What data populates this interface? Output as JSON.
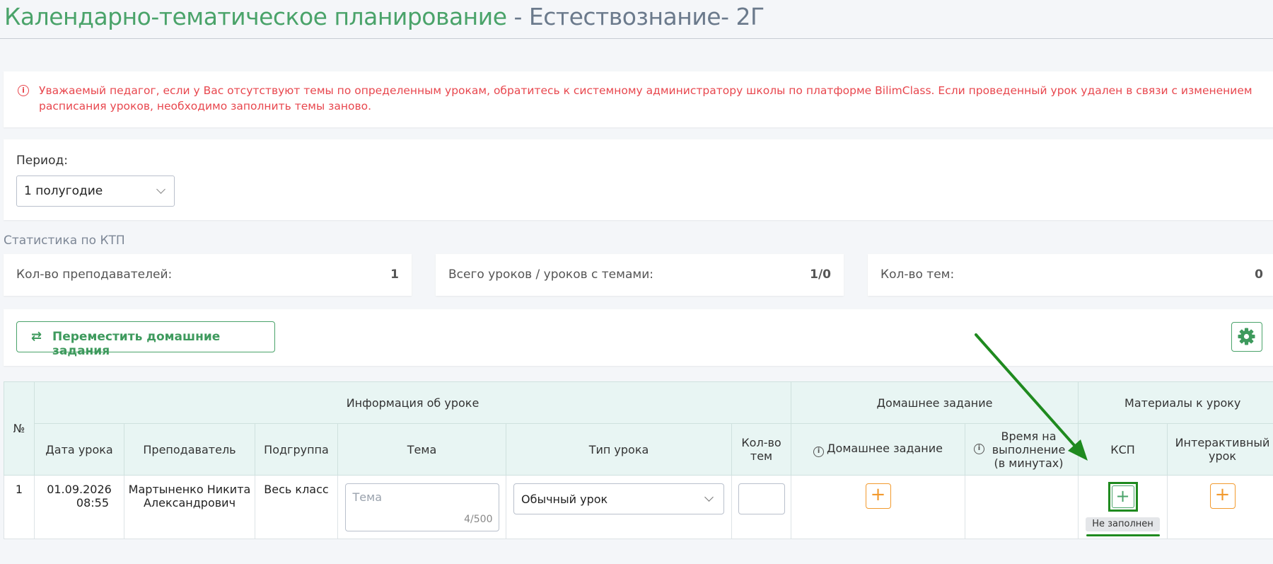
{
  "page": {
    "title_main": "Календарно-тематическое планирование",
    "title_sub": " - Естествознание- 2Г"
  },
  "alert": {
    "icon": "info-circle-icon",
    "text": "Уважаемый педагог, если у Вас отсутствуют темы по определенным урокам, обратитесь к системному администратору школы по платформе BilimClass. Если проведенный урок удален в связи с изменением расписания уроков, необходимо заполнить темы заново."
  },
  "period": {
    "label": "Период:",
    "value": "1 полугодие"
  },
  "stats": {
    "title": "Статистика по КТП",
    "items": [
      {
        "label": "Кол-во преподавателей:",
        "value": "1"
      },
      {
        "label": "Всего уроков / уроков с темами:",
        "value": "1/0"
      },
      {
        "label": "Кол-во тем:",
        "value": "0"
      }
    ]
  },
  "toolbar": {
    "move_label": "Переместить домашние задания"
  },
  "table": {
    "groups": {
      "num": "№",
      "info": "Информация об уроке",
      "homework": "Домашнее задание",
      "materials": "Материалы к уроку"
    },
    "columns": {
      "date": "Дата урока",
      "teacher": "Преподаватель",
      "subgroup": "Подгруппа",
      "topic": "Тема",
      "type": "Тип урока",
      "count": "Кол-во тем",
      "homework": "Домашнее задание",
      "time": "Время на выполнение (в минутах)",
      "ksp": "КСП",
      "interactive": "Интерактивный урок"
    },
    "rows": [
      {
        "num": "1",
        "date": "01.09.2026",
        "time": "08:55",
        "teacher": "Мартыненко Никита Александрович",
        "subgroup": "Весь класс",
        "topic_placeholder": "Тема",
        "topic_counter": "4/500",
        "type": "Обычный урок",
        "ksp_status": "Не заполнен"
      }
    ]
  },
  "colors": {
    "green": "#4aa36a",
    "red": "#e8474e",
    "orange": "#f29a2e",
    "header_bg": "#e8f5f3",
    "annotation": "#1f8a1f"
  }
}
